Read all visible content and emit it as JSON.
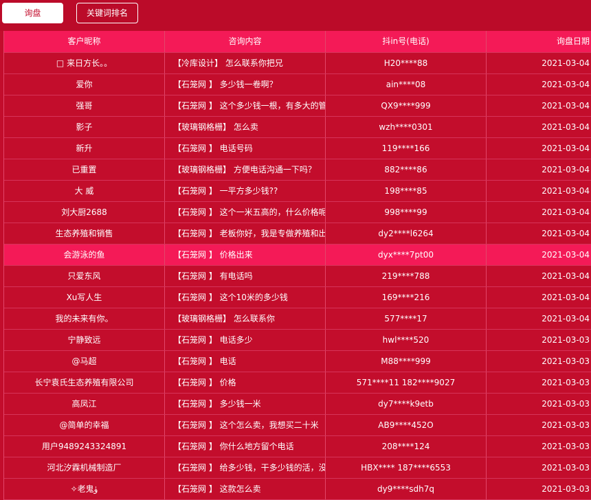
{
  "tabs": [
    {
      "label": "询盘"
    },
    {
      "label": "关键词排名"
    }
  ],
  "table": {
    "columns": [
      "客户昵称",
      "咨询内容",
      "抖in号(电话)",
      "询盘日期"
    ],
    "rows": [
      {
        "name": "□ 来日方长。。",
        "content": "【冷库设计】 怎么联系你把兄",
        "contact": "H20****88",
        "date": "2021-03-04"
      },
      {
        "name": "爱你",
        "content": "【石笼网 】 多少钱一卷啊？",
        "contact": "ain****08",
        "date": "2021-03-04"
      },
      {
        "name": "强哥",
        "content": "【石笼网 】 这个多少钱一根，有多大的管;多长",
        "contact": "QX9****999",
        "date": "2021-03-04"
      },
      {
        "name": "影子",
        "content": "【玻璃钢格栅】 怎么卖",
        "contact": "wzh****0301",
        "date": "2021-03-04"
      },
      {
        "name": "新升",
        "content": "【石笼网 】 电话号码",
        "contact": "119****166",
        "date": "2021-03-04"
      },
      {
        "name": "已重置",
        "content": "【玻璃钢格栅】 方便电话沟通一下吗？",
        "contact": "882****86",
        "date": "2021-03-04"
      },
      {
        "name": "大 威",
        "content": "【石笼网 】 一平方多少钱??",
        "contact": "198****85",
        "date": "2021-03-04"
      },
      {
        "name": "刘大厨2688",
        "content": "【石笼网 】 这个一米五高的，什么价格呢？",
        "contact": "998****99",
        "date": "2021-03-04"
      },
      {
        "name": "生态养殖和销售",
        "content": "【石笼网 】 老板你好，我是专做养殖和出售鹅",
        "contact": "dy2****l6264",
        "date": "2021-03-04"
      },
      {
        "name": "会游泳的鱼",
        "content": "【石笼网 】 价格出来",
        "contact": "dyx****7pt00",
        "date": "2021-03-04"
      },
      {
        "name": "只爱东风",
        "content": "【石笼网 】 有电话吗",
        "contact": "219****788",
        "date": "2021-03-04"
      },
      {
        "name": "Xu写人生",
        "content": "【石笼网 】 这个10米的多少钱",
        "contact": "169****216",
        "date": "2021-03-04"
      },
      {
        "name": "我的未来有你。",
        "content": "【玻璃钢格栅】 怎么联系你",
        "contact": "577****17",
        "date": "2021-03-04"
      },
      {
        "name": "宁静致远",
        "content": "【石笼网 】 电话多少",
        "contact": "hwl****520",
        "date": "2021-03-03"
      },
      {
        "name": "@马超",
        "content": "【石笼网 】 电话",
        "contact": "M88****999",
        "date": "2021-03-03"
      },
      {
        "name": "长宁袁氏生态养殖有限公司",
        "content": "【石笼网 】 价格",
        "contact": "571****11 182****9027",
        "date": "2021-03-03"
      },
      {
        "name": "高凤江",
        "content": "【石笼网 】 多少钱一米",
        "contact": "dy7****k9etb",
        "date": "2021-03-03"
      },
      {
        "name": "@简单的幸福",
        "content": "【石笼网 】 这个怎么卖，我想买二十米",
        "contact": "AB9****452O",
        "date": "2021-03-03"
      },
      {
        "name": "用户9489243324891",
        "content": "【石笼网 】 你什么地方留个电话",
        "contact": "208****124",
        "date": "2021-03-03"
      },
      {
        "name": "河北汐霖机械制造厂",
        "content": "【石笼网 】 给多少钱，干多少钱的活，没毛病",
        "contact": "HBX**** 187****6553",
        "date": "2021-03-03"
      },
      {
        "name": "✧老鬼ۈ",
        "content": "【石笼网 】 这款怎么卖",
        "contact": "dy9****sdh7q",
        "date": "2021-03-03"
      }
    ],
    "highlighted_row": 9
  },
  "colors": {
    "background": "#c30d2c",
    "header": "#f41a57",
    "highlight": "#f41a57",
    "text": "#ffffff"
  }
}
